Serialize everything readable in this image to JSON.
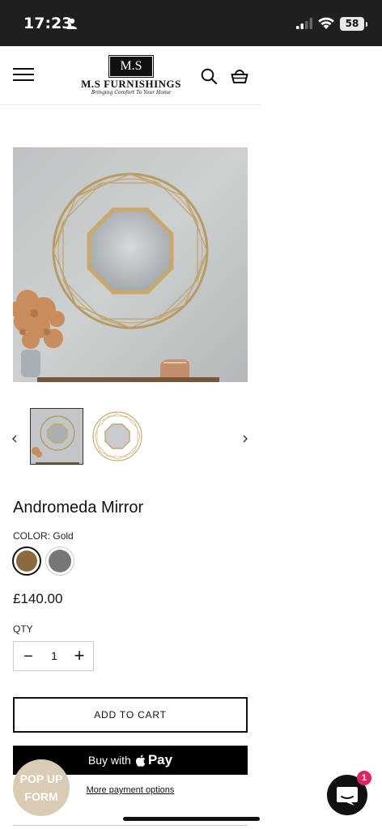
{
  "status_bar": {
    "time": "17:23",
    "battery": "58"
  },
  "header": {
    "logo_monogram": "M.S",
    "logo_name": "M.S FURNISHINGS",
    "logo_tagline": "Bringing Comfort To Your Home",
    "menu_icon": "hamburger-icon",
    "search_icon": "search-icon",
    "cart_icon": "basket-icon"
  },
  "product": {
    "title": "Andromeda Mirror",
    "color_label": "COLOR:",
    "color_value": "Gold",
    "swatches": [
      {
        "name": "Gold",
        "color": "#8b6a3e",
        "selected": true
      },
      {
        "name": "Grey",
        "color": "#77777a",
        "selected": false
      }
    ],
    "price": "£140.00",
    "qty_label": "QTY",
    "qty_value": "1",
    "qty_minus": "−",
    "qty_plus": "+",
    "add_to_cart": "ADD TO CART",
    "buy_with": "Buy with",
    "apple_pay": "Pay",
    "more_options": "More payment options"
  },
  "widgets": {
    "popup_line1": "POP UP",
    "popup_line2": "FORM",
    "chat_badge": "1"
  },
  "colors": {
    "status_bg": "#1e1f21",
    "popup_bg": "#d9cbb4",
    "badge": "#e0245e"
  }
}
